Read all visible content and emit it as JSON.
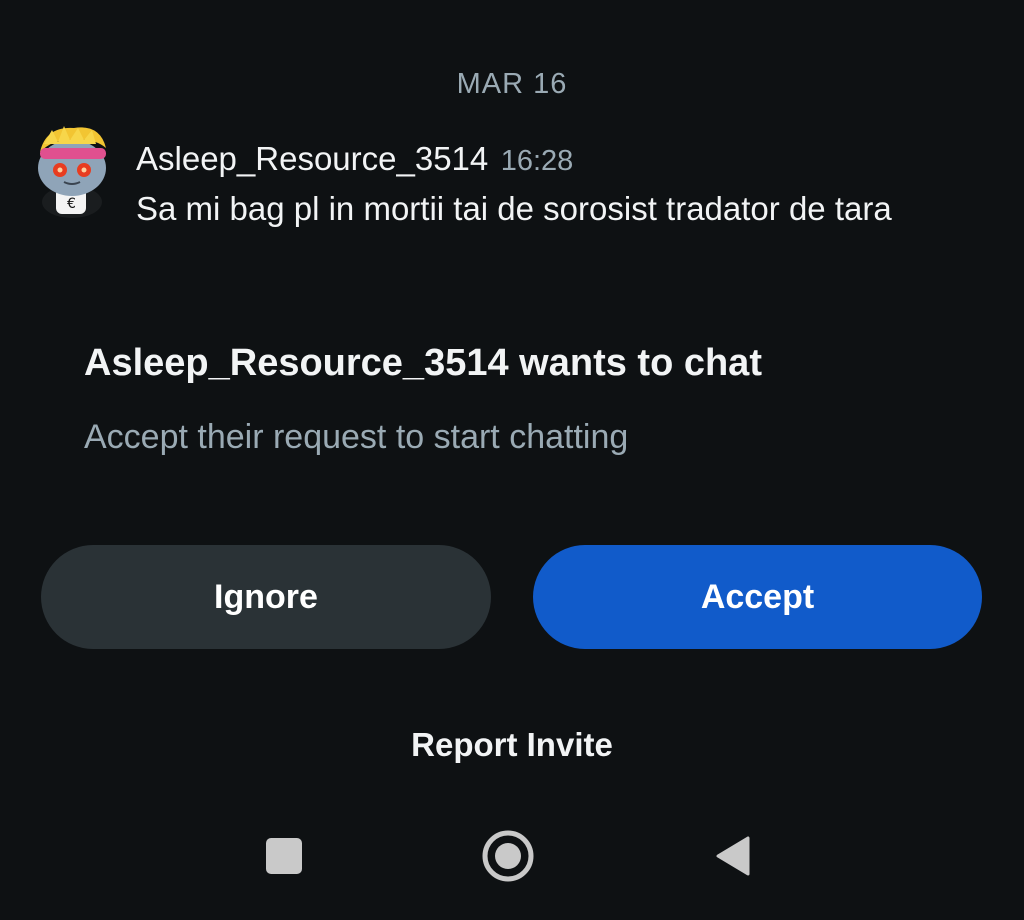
{
  "date_separator": "MAR 16",
  "message": {
    "username": "Asleep_Resource_3514",
    "time": "16:28",
    "text": "Sa mi bag pl in mortii tai de sorosist tradator de tara",
    "avatar_icon": "reddit-snoo-avatar-icon"
  },
  "request": {
    "title": "Asleep_Resource_3514 wants to chat",
    "subtitle": "Accept their request to start chatting"
  },
  "buttons": {
    "ignore_label": "Ignore",
    "accept_label": "Accept"
  },
  "report_label": "Report Invite",
  "nav_bar": {
    "recents_icon": "square-icon",
    "home_icon": "circle-icon",
    "back_icon": "triangle-back-icon"
  },
  "colors": {
    "background": "#0e1113",
    "accent": "#115bca",
    "secondary_button": "#2a3236",
    "muted_text": "#9aaab4",
    "primary_text": "#f2f4f5"
  }
}
